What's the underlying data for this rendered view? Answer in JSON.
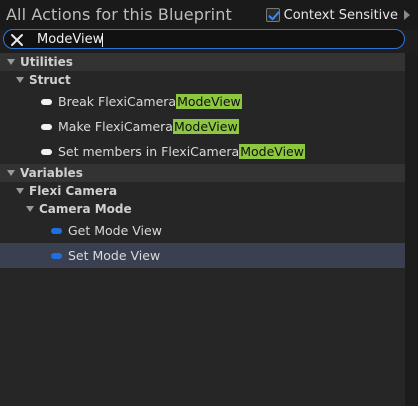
{
  "header": {
    "title": "All Actions for this Blueprint",
    "context_sensitive_label": "Context Sensitive",
    "context_sensitive_checked": true
  },
  "search": {
    "value": "ModeView",
    "clear_icon": "close-icon"
  },
  "tree": {
    "utilities": {
      "label": "Utilities",
      "struct": {
        "label": "Struct",
        "items": [
          {
            "prefix": "Break FlexiCamera",
            "match": "ModeView"
          },
          {
            "prefix": "Make FlexiCamera",
            "match": "ModeView"
          },
          {
            "prefix": "Set members in FlexiCamera",
            "match": "ModeView"
          }
        ]
      }
    },
    "variables": {
      "label": "Variables",
      "flexi_camera": {
        "label": "Flexi Camera",
        "camera_mode": {
          "label": "Camera Mode",
          "items": [
            {
              "label": "Get Mode View"
            },
            {
              "label": "Set Mode View"
            }
          ]
        }
      }
    }
  },
  "colors": {
    "accent": "#2e74d8",
    "highlight": "#8dc63f",
    "pin_variable": "#1f6fe0",
    "pin_struct": "#f2f2f2",
    "selected_row": "#3a4050"
  }
}
